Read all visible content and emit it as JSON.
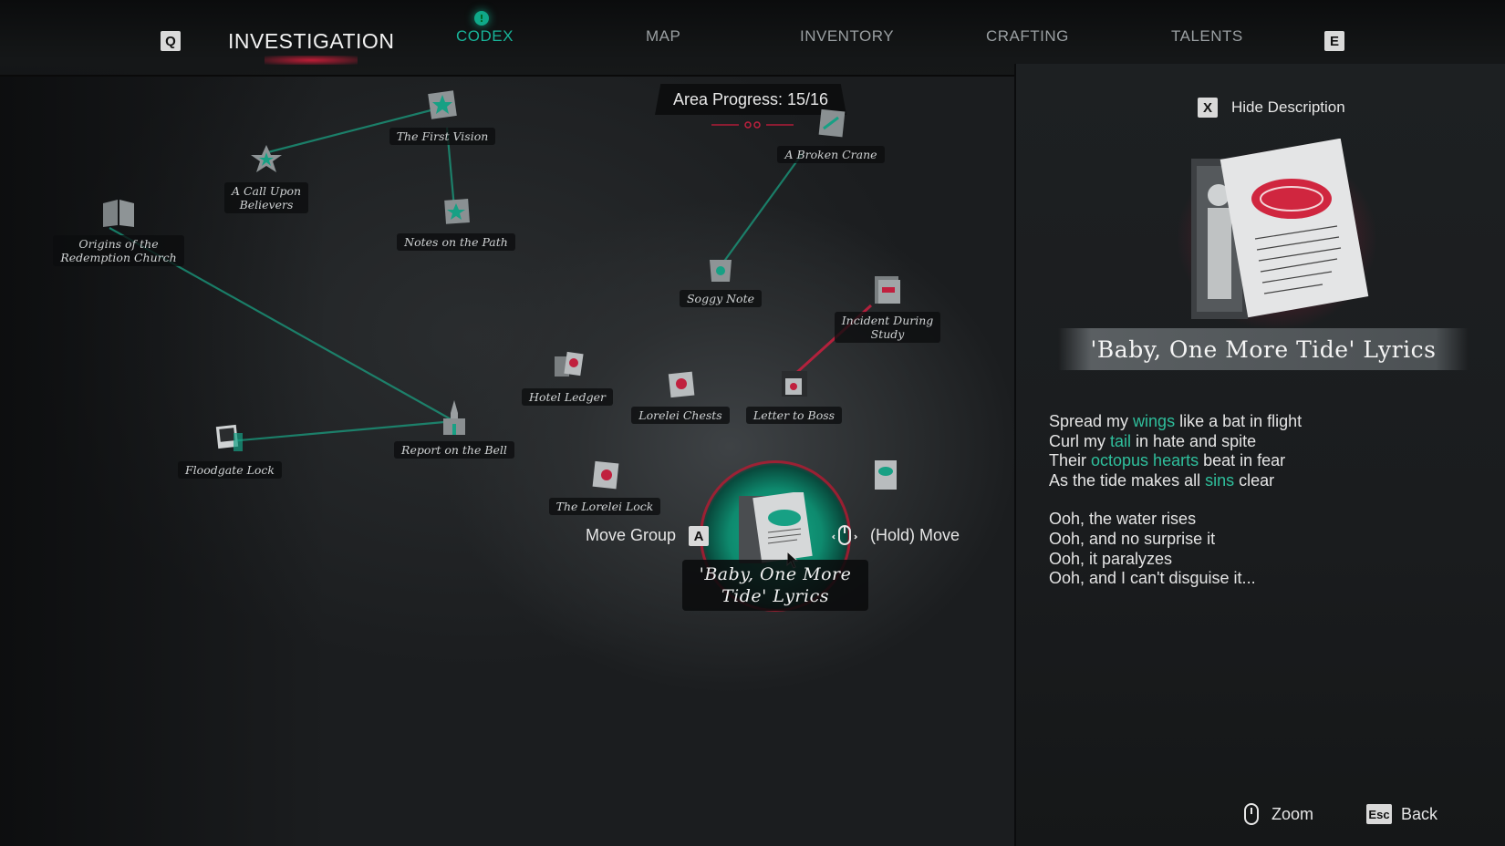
{
  "header": {
    "left_key": "Q",
    "right_key": "E",
    "tabs": [
      {
        "label": "INVESTIGATION"
      },
      {
        "label": "CODEX"
      },
      {
        "label": "MAP"
      },
      {
        "label": "INVENTORY"
      },
      {
        "label": "CRAFTING"
      },
      {
        "label": "TALENTS"
      }
    ],
    "codex_alert": "!"
  },
  "board": {
    "progress_label": "Area Progress: 15/16",
    "nodes": [
      {
        "label": "The First Vision"
      },
      {
        "label": "A Broken Crane"
      },
      {
        "label": "A Call Upon\nBelievers"
      },
      {
        "label": "Origins of the\nRedemption Church"
      },
      {
        "label": "Notes on the Path"
      },
      {
        "label": "Soggy Note"
      },
      {
        "label": "Incident During\nStudy"
      },
      {
        "label": "Hotel Ledger"
      },
      {
        "label": "Lorelei Chests"
      },
      {
        "label": "Letter to Boss"
      },
      {
        "label": "Report on the Bell"
      },
      {
        "label": "Floodgate Lock"
      },
      {
        "label": "The Lorelei Lock"
      }
    ],
    "selected": {
      "label": "'Baby, One More\nTide' Lyrics"
    },
    "hints": {
      "move_group": "Move Group",
      "move_group_key": "A",
      "hold_move": "(Hold) Move"
    }
  },
  "panel": {
    "hide_key": "X",
    "hide_label": "Hide Description",
    "title": "'Baby, One More Tide' Lyrics",
    "verse1": [
      {
        "a": "Spread my ",
        "h": "wings",
        "b": " like a bat in flight"
      },
      {
        "a": "Curl my ",
        "h": "tail",
        "b": " in hate and spite"
      },
      {
        "a": "Their ",
        "h": "octopus hearts",
        "b": " beat in fear"
      },
      {
        "a": "As the tide makes all ",
        "h": "sins",
        "b": " clear"
      }
    ],
    "verse2": [
      "Ooh, the water rises",
      "Ooh, and no surprise it",
      "Ooh, it paralyzes",
      "Ooh, and I can't disguise it..."
    ]
  },
  "footer": {
    "zoom_label": "Zoom",
    "back_key": "Esc",
    "back_label": "Back"
  }
}
